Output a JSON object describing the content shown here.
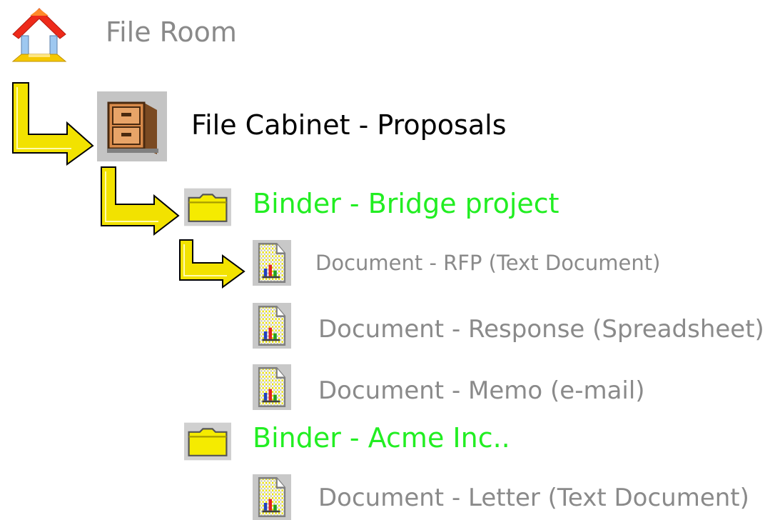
{
  "colors": {
    "file_room_text": "#8a8a8a",
    "cabinet_text": "#000000",
    "binder_text": "#22ee22",
    "document_text": "#8a8a8a",
    "arrow_fill": "#f2e200",
    "arrow_stroke": "#000000"
  },
  "tree": {
    "file_room": {
      "label": "File Room",
      "icon": "home-icon"
    },
    "cabinet": {
      "label": "File Cabinet - Proposals",
      "icon": "file-cabinet-icon"
    },
    "binder_bridge": {
      "label": "Binder - Bridge project",
      "icon": "folder-icon"
    },
    "doc_rfp": {
      "label": "Document  - RFP (Text Document)",
      "icon": "document-icon"
    },
    "doc_response": {
      "label": "Document  - Response (Spreadsheet)",
      "icon": "document-icon"
    },
    "doc_memo": {
      "label": "Document  - Memo (e-mail)",
      "icon": "document-icon"
    },
    "binder_acme": {
      "label": "Binder - Acme Inc..",
      "icon": "folder-icon"
    },
    "doc_letter": {
      "label": "Document  - Letter  (Text Document)",
      "icon": "document-icon"
    }
  }
}
